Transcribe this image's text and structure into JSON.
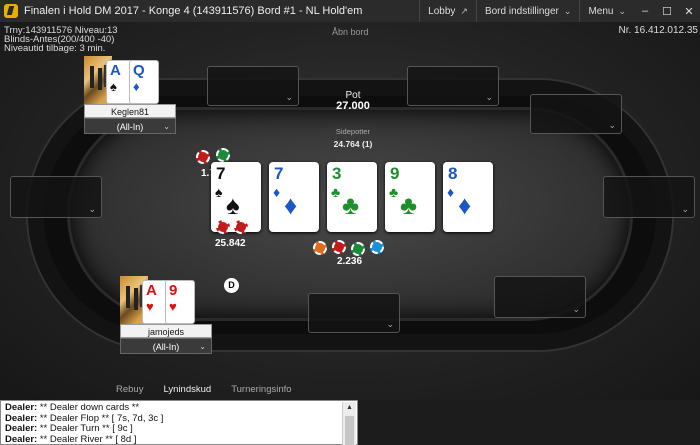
{
  "titlebar": {
    "title": "Finalen i Hold DM 2017 - Konge 4 (143911576) Bord #1 -  NL  Hold'em",
    "lobby": "Lobby",
    "table_settings": "Bord indstillinger",
    "menu": "Menu",
    "minimize": "–",
    "maximize": "☐",
    "close": "✕"
  },
  "info": {
    "tournament": "Trny:143911576 Niveau:13",
    "blinds": "Blinds-Antes(200/400 -40)",
    "level_time": "Niveautid tilbage: 3 min.",
    "hand_number": "Nr. 16.412.012.35",
    "open_seat": "Åbn bord"
  },
  "pot": {
    "label": "Pot",
    "value": "27.000",
    "side_label": "Sidepotter",
    "side_value": "24.764 (1)"
  },
  "players": {
    "top": {
      "name": "Keglen81",
      "status": "(All-In)",
      "card1_rank": "A",
      "card1_suit": "♠",
      "card2_rank": "Q",
      "card2_suit": "♦",
      "bet": "1.7"
    },
    "bottom": {
      "name": "jamojeds",
      "status": "(All-In)",
      "card1_rank": "A",
      "card1_suit": "♥",
      "card2_rank": "9",
      "card2_suit": "♥",
      "bet": "25.842"
    }
  },
  "board": [
    {
      "rank": "7",
      "suit": "♠",
      "color": "black"
    },
    {
      "rank": "7",
      "suit": "♦",
      "color": "blue"
    },
    {
      "rank": "3",
      "suit": "♣",
      "color": "green"
    },
    {
      "rank": "9",
      "suit": "♣",
      "color": "green"
    },
    {
      "rank": "8",
      "suit": "♦",
      "color": "blue"
    }
  ],
  "center_chips_value": "2.236",
  "dealer": "D",
  "tabs": {
    "rebuy": "Rebuy",
    "lightning": "Lynindskud",
    "tournament_info": "Turneringsinfo"
  },
  "log": [
    {
      "who": "Dealer:",
      "text": " ** Dealer down cards **"
    },
    {
      "who": "Dealer:",
      "text": " ** Dealer Flop ** [ 7s, 7d, 3c ]"
    },
    {
      "who": "Dealer:",
      "text": " ** Dealer Turn ** [ 9c ]"
    },
    {
      "who": "Dealer:",
      "text": " ** Dealer River ** [ 8d ]"
    }
  ],
  "colors": {
    "accent": "#e9b000",
    "felt": "#333333",
    "chip_red": "#c21b1b",
    "chip_green": "#1a8a3b",
    "chip_blue": "#1991d8"
  }
}
